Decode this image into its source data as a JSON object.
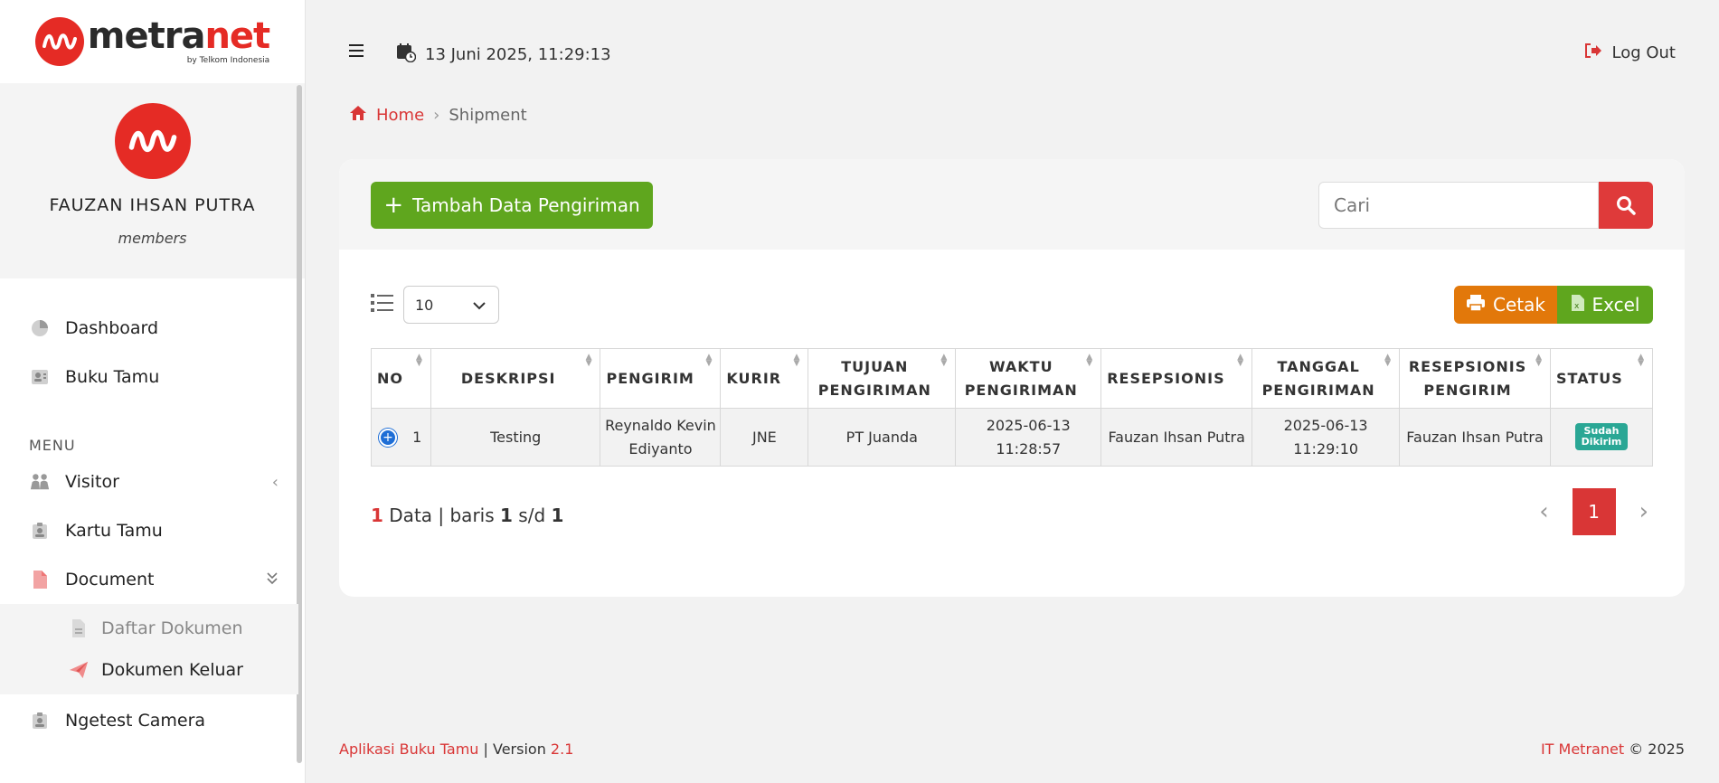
{
  "brand": {
    "name_left": "metra",
    "name_right": "net",
    "sub": "by Telkom Indonesia",
    "color": "#e52b25"
  },
  "profile": {
    "name": "FAUZAN IHSAN PUTRA",
    "role": "members"
  },
  "nav": {
    "items": [
      {
        "label": "Dashboard",
        "icon": "pie-chart-icon"
      },
      {
        "label": "Buku Tamu",
        "icon": "contact-card-icon"
      }
    ],
    "section": "MENU",
    "menu": [
      {
        "label": "Visitor",
        "icon": "people-icon"
      },
      {
        "label": "Kartu Tamu",
        "icon": "id-badge-icon"
      },
      {
        "label": "Document",
        "icon": "document-icon"
      }
    ],
    "sub": [
      {
        "label": "Daftar Dokumen",
        "icon": "file-icon"
      },
      {
        "label": "Dokumen Keluar",
        "icon": "paper-plane-icon"
      }
    ],
    "extra": {
      "label": "Ngetest Camera",
      "icon": "id-badge-icon"
    }
  },
  "topbar": {
    "datetime": "13 Juni 2025, 11:29:13",
    "logout": "Log Out"
  },
  "breadcrumb": {
    "home": "Home",
    "current": "Shipment"
  },
  "actions": {
    "add": "Tambah Data Pengiriman",
    "search_placeholder": "Cari",
    "page_size": "10",
    "print": "Cetak",
    "excel": "Excel"
  },
  "table": {
    "headers": [
      "NO",
      "DESKRIPSI",
      "PENGIRIM",
      "KURIR",
      "TUJUAN PENGIRIMAN",
      "WAKTU PENGIRIMAN",
      "RESEPSIONIS",
      "TANGGAL PENGIRIMAN",
      "RESEPSIONIS PENGIRIM",
      "STATUS"
    ],
    "rows": [
      {
        "no": "1",
        "deskripsi": "Testing",
        "pengirim": "Reynaldo Kevin Ediyanto",
        "kurir": "JNE",
        "tujuan": "PT Juanda",
        "waktu": "2025-06-13 11:28:57",
        "resepsionis": "Fauzan Ihsan Putra",
        "tanggal": "2025-06-13 11:29:10",
        "resepsionis_pengirim": "Fauzan Ihsan Putra",
        "status": "Sudah Dikirim"
      }
    ]
  },
  "summary": {
    "count": "1",
    "text1": "Data | baris",
    "from": "1",
    "text2": "s/d",
    "to": "1"
  },
  "pagination": {
    "current": "1"
  },
  "footer": {
    "app": "Aplikasi Buku Tamu",
    "sep": "| Version",
    "version": "2.1",
    "company": "IT Metranet",
    "copyright": "© 2025"
  }
}
